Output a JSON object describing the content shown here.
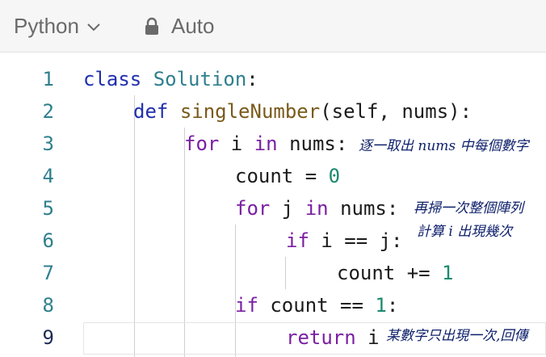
{
  "toolbar": {
    "language": "Python",
    "mode": "Auto",
    "icons": [
      "chevron-down-icon",
      "lock-icon"
    ]
  },
  "editor": {
    "active_line": 9,
    "lines": [
      {
        "n": "1",
        "tokens": [
          [
            "kw2",
            "class"
          ],
          [
            "",
            " "
          ],
          [
            "cls",
            "Solution"
          ],
          [
            "",
            ":"
          ]
        ]
      },
      {
        "n": "2",
        "tokens": [
          [
            "kw2",
            "def"
          ],
          [
            "",
            " "
          ],
          [
            "fn",
            "singleNumber"
          ],
          [
            "",
            "(self, nums):"
          ]
        ]
      },
      {
        "n": "3",
        "tokens": [
          [
            "kw",
            "for"
          ],
          [
            "",
            " i "
          ],
          [
            "kw",
            "in"
          ],
          [
            "",
            " nums:"
          ]
        ]
      },
      {
        "n": "4",
        "tokens": [
          [
            "",
            "count = "
          ],
          [
            "num",
            "0"
          ]
        ]
      },
      {
        "n": "5",
        "tokens": [
          [
            "kw",
            "for"
          ],
          [
            "",
            " j "
          ],
          [
            "kw",
            "in"
          ],
          [
            "",
            " nums:"
          ]
        ]
      },
      {
        "n": "6",
        "tokens": [
          [
            "kw",
            "if"
          ],
          [
            "",
            " i == j:"
          ]
        ]
      },
      {
        "n": "7",
        "tokens": [
          [
            "",
            "count += "
          ],
          [
            "num",
            "1"
          ]
        ]
      },
      {
        "n": "8",
        "tokens": [
          [
            "kw",
            "if"
          ],
          [
            "",
            " count == "
          ],
          [
            "num",
            "1"
          ],
          [
            "",
            ":"
          ]
        ]
      },
      {
        "n": "9",
        "tokens": [
          [
            "kw",
            "return"
          ],
          [
            "",
            " i"
          ]
        ]
      }
    ]
  },
  "annotations": {
    "note1": "逐一取出 nums 中每個數字",
    "note2a": "再掃一次整個陣列",
    "note2b": "計算 i 出現幾次",
    "note3": "某數字只出現一次,回傳"
  },
  "colors": {
    "keyword": "#7a1fa2",
    "class": "#2f7f8f",
    "number": "#1a8a6e",
    "handwriting": "#0d1f6b"
  }
}
